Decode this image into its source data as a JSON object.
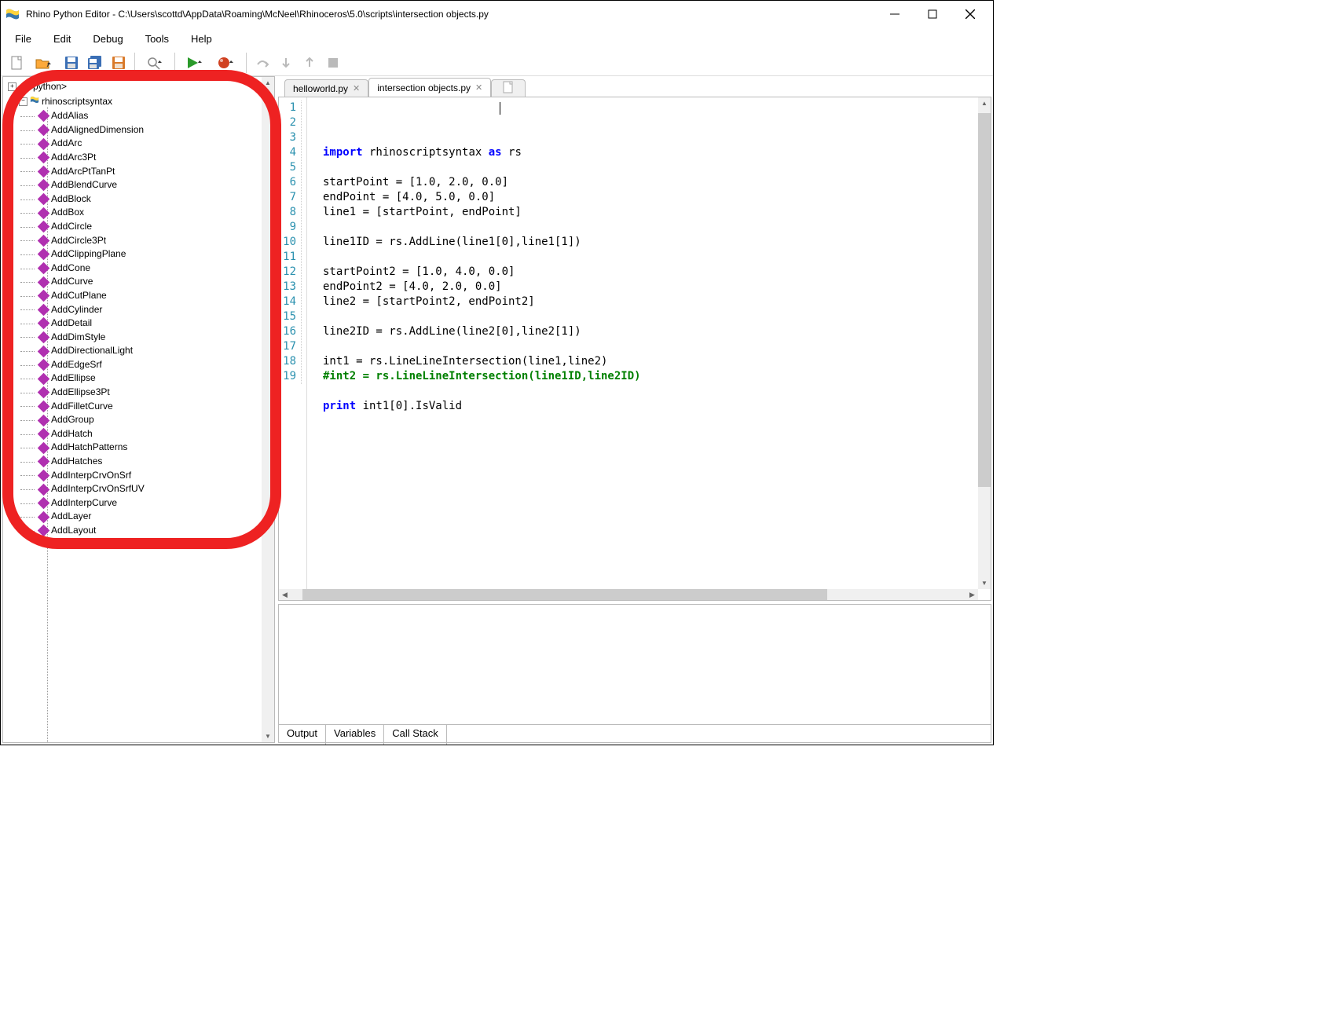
{
  "window": {
    "title": "Rhino Python Editor - C:\\Users\\scottd\\AppData\\Roaming\\McNeel\\Rhinoceros\\5.0\\scripts\\intersection objects.py"
  },
  "menu": {
    "items": [
      "File",
      "Edit",
      "Debug",
      "Tools",
      "Help"
    ]
  },
  "tree": {
    "root": "<python>",
    "module": "rhinoscriptsyntax",
    "items": [
      "AddAlias",
      "AddAlignedDimension",
      "AddArc",
      "AddArc3Pt",
      "AddArcPtTanPt",
      "AddBlendCurve",
      "AddBlock",
      "AddBox",
      "AddCircle",
      "AddCircle3Pt",
      "AddClippingPlane",
      "AddCone",
      "AddCurve",
      "AddCutPlane",
      "AddCylinder",
      "AddDetail",
      "AddDimStyle",
      "AddDirectionalLight",
      "AddEdgeSrf",
      "AddEllipse",
      "AddEllipse3Pt",
      "AddFilletCurve",
      "AddGroup",
      "AddHatch",
      "AddHatchPatterns",
      "AddHatches",
      "AddInterpCrvOnSrf",
      "AddInterpCrvOnSrfUV",
      "AddInterpCurve",
      "AddLayer",
      "AddLayout"
    ]
  },
  "tabs": {
    "inactive": "helloworld.py",
    "active": "intersection objects.py"
  },
  "code": {
    "lines": [
      {
        "n": "1",
        "html": "<span class='kw'>import</span> rhinoscriptsyntax <span class='kw2'>as</span> rs"
      },
      {
        "n": "2",
        "html": ""
      },
      {
        "n": "3",
        "html": "startPoint = [1.0, 2.0, 0.0]"
      },
      {
        "n": "4",
        "html": "endPoint = [4.0, 5.0, 0.0]"
      },
      {
        "n": "5",
        "html": "line1 = [startPoint, endPoint]"
      },
      {
        "n": "6",
        "html": ""
      },
      {
        "n": "7",
        "html": "line1ID = rs.AddLine(line1[0],line1[1])"
      },
      {
        "n": "8",
        "html": ""
      },
      {
        "n": "9",
        "html": "startPoint2 = [1.0, 4.0, 0.0]"
      },
      {
        "n": "10",
        "html": "endPoint2 = [4.0, 2.0, 0.0]"
      },
      {
        "n": "11",
        "html": "line2 = [startPoint2, endPoint2]"
      },
      {
        "n": "12",
        "html": ""
      },
      {
        "n": "13",
        "html": "line2ID = rs.AddLine(line2[0],line2[1])"
      },
      {
        "n": "14",
        "html": ""
      },
      {
        "n": "15",
        "html": "int1 = rs.LineLineIntersection(line1,line2)"
      },
      {
        "n": "16",
        "html": "<span class='comment'>#int2 = rs.LineLineIntersection(line1ID,line2ID)</span>"
      },
      {
        "n": "17",
        "html": ""
      },
      {
        "n": "18",
        "html": "<span class='kw'>print</span> int1[0].IsValid"
      },
      {
        "n": "19",
        "html": ""
      }
    ]
  },
  "output": {
    "tabs": [
      "Output",
      "Variables",
      "Call Stack"
    ]
  }
}
